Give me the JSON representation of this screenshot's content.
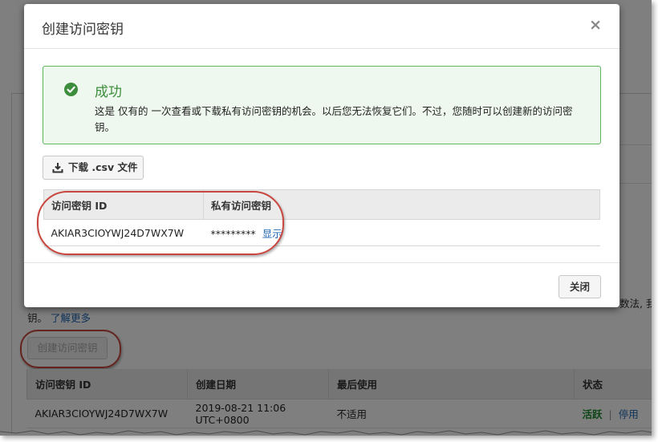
{
  "background": {
    "learn_more_prefix": "钥。",
    "learn_more_link": "了解更多",
    "right_text": "数法, 我",
    "create_button_label": "创建访问密钥",
    "table": {
      "headers": [
        "访问密钥 ID",
        "创建日期",
        "最后使用",
        "状态"
      ],
      "row": {
        "key_id": "AKIAR3CIOYWJ24D7WX7W",
        "created": "2019-08-21 11:06 UTC+0800",
        "last_used": "不适用",
        "status": "活跃",
        "separator": "|",
        "action": "停用"
      }
    }
  },
  "modal": {
    "title": "创建访问密钥",
    "close_glyph": "×",
    "alert": {
      "title": "成功",
      "body": "这是 仅有的 一次查看或下载私有访问密钥的机会。以后您无法恢复它们。不过，您随时可以创建新的访问密钥。"
    },
    "download_button_label": "下载 .csv 文件",
    "key_table": {
      "headers": [
        "访问密钥 ID",
        "私有访问密钥"
      ],
      "row": {
        "key_id": "AKIAR3CIOYWJ24D7WX7W",
        "secret_masked": "*********",
        "show_link": "显示"
      }
    },
    "footer_close_label": "关闭"
  },
  "colors": {
    "success_green": "#3c8e3c",
    "link_blue": "#1f66b5",
    "highlight_red": "#c9463e"
  },
  "icons": {
    "alert": "check-circle-icon",
    "download": "download-icon",
    "close": "close-icon"
  }
}
